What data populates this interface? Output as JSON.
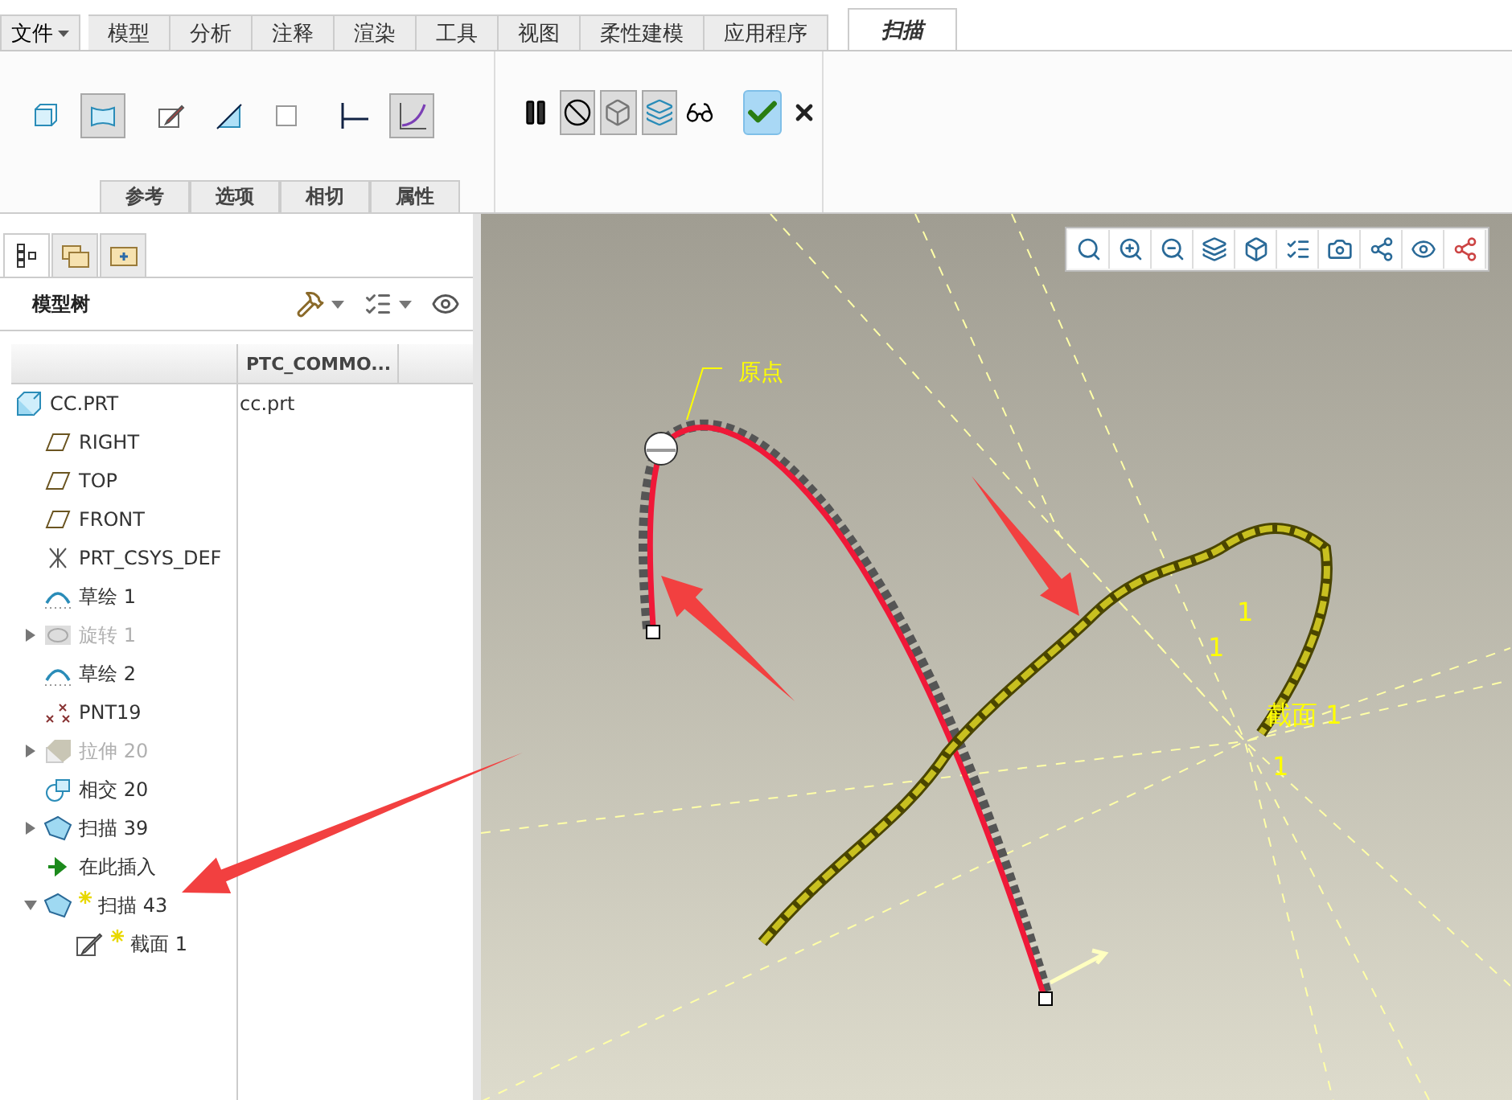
{
  "file_menu": {
    "label": "文件"
  },
  "tabs": [
    {
      "label": "模型",
      "selected": false
    },
    {
      "label": "分析",
      "selected": false
    },
    {
      "label": "注释",
      "selected": false
    },
    {
      "label": "渲染",
      "selected": false
    },
    {
      "label": "工具",
      "selected": false
    },
    {
      "label": "视图",
      "selected": false
    },
    {
      "label": "柔性建模",
      "selected": false
    },
    {
      "label": "应用程序",
      "selected": false
    },
    {
      "label": "扫描",
      "selected": true
    }
  ],
  "ribbon_tools": [
    {
      "kind": "solid",
      "selected": false
    },
    {
      "kind": "surface",
      "selected": true
    },
    {
      "kind": "sketch",
      "selected": false
    },
    {
      "kind": "remove",
      "selected": false
    },
    {
      "kind": "thicken",
      "selected": false
    },
    {
      "kind": "constant",
      "selected": false
    },
    {
      "kind": "variable",
      "selected": true
    }
  ],
  "sub_tabs": [
    {
      "label": "参考"
    },
    {
      "label": "选项"
    },
    {
      "label": "相切"
    },
    {
      "label": "属性"
    }
  ],
  "control_tools": [
    {
      "kind": "pause",
      "selected": false
    },
    {
      "kind": "no-preview",
      "selected": true
    },
    {
      "kind": "preview-mesh",
      "selected": true
    },
    {
      "kind": "preview-solid",
      "selected": true
    },
    {
      "kind": "glasses",
      "selected": false
    },
    {
      "kind": "ok",
      "selected": true
    },
    {
      "kind": "cancel",
      "selected": false
    }
  ],
  "panel_tabs": [
    {
      "kind": "tree",
      "selected": true
    },
    {
      "kind": "folders",
      "selected": false
    },
    {
      "kind": "favorites",
      "selected": false
    }
  ],
  "tree": {
    "title": "模型树",
    "columns": [
      "PTC_COMMO..."
    ],
    "rows": [
      {
        "label": "CC.PRT",
        "kind": "part",
        "value": "cc.prt",
        "suppressed": false,
        "new": false
      },
      {
        "label": "RIGHT",
        "kind": "plane",
        "suppressed": false,
        "new": false
      },
      {
        "label": "TOP",
        "kind": "plane",
        "suppressed": false,
        "new": false
      },
      {
        "label": "FRONT",
        "kind": "plane",
        "suppressed": false,
        "new": false
      },
      {
        "label": "PRT_CSYS_DEF",
        "kind": "csys",
        "suppressed": false,
        "new": false
      },
      {
        "label": "草绘 1",
        "kind": "sketch",
        "suppressed": false,
        "new": false
      },
      {
        "label": "旋转 1",
        "kind": "revolve",
        "suppressed": true,
        "new": false,
        "expanded": false
      },
      {
        "label": "草绘 2",
        "kind": "sketch",
        "suppressed": false,
        "new": false
      },
      {
        "label": "PNT19",
        "kind": "point",
        "suppressed": false,
        "new": false
      },
      {
        "label": "拉伸 20",
        "kind": "extrude",
        "suppressed": true,
        "new": false,
        "expanded": false
      },
      {
        "label": "相交 20",
        "kind": "intersect",
        "suppressed": false,
        "new": false
      },
      {
        "label": "扫描 39",
        "kind": "sweep",
        "suppressed": false,
        "new": false,
        "expanded": false
      },
      {
        "label": "在此插入",
        "kind": "insert",
        "suppressed": false,
        "new": false
      },
      {
        "label": "扫描 43",
        "kind": "sweep",
        "suppressed": false,
        "new": true,
        "expanded": true,
        "children": [
          {
            "label": "截面 1",
            "kind": "section",
            "suppressed": false,
            "new": true
          }
        ]
      }
    ]
  },
  "viewport": {
    "labels": [
      {
        "text": "原点"
      },
      {
        "text": "1"
      },
      {
        "text": "1"
      },
      {
        "text": "截面 1"
      },
      {
        "text": "1"
      }
    ]
  }
}
